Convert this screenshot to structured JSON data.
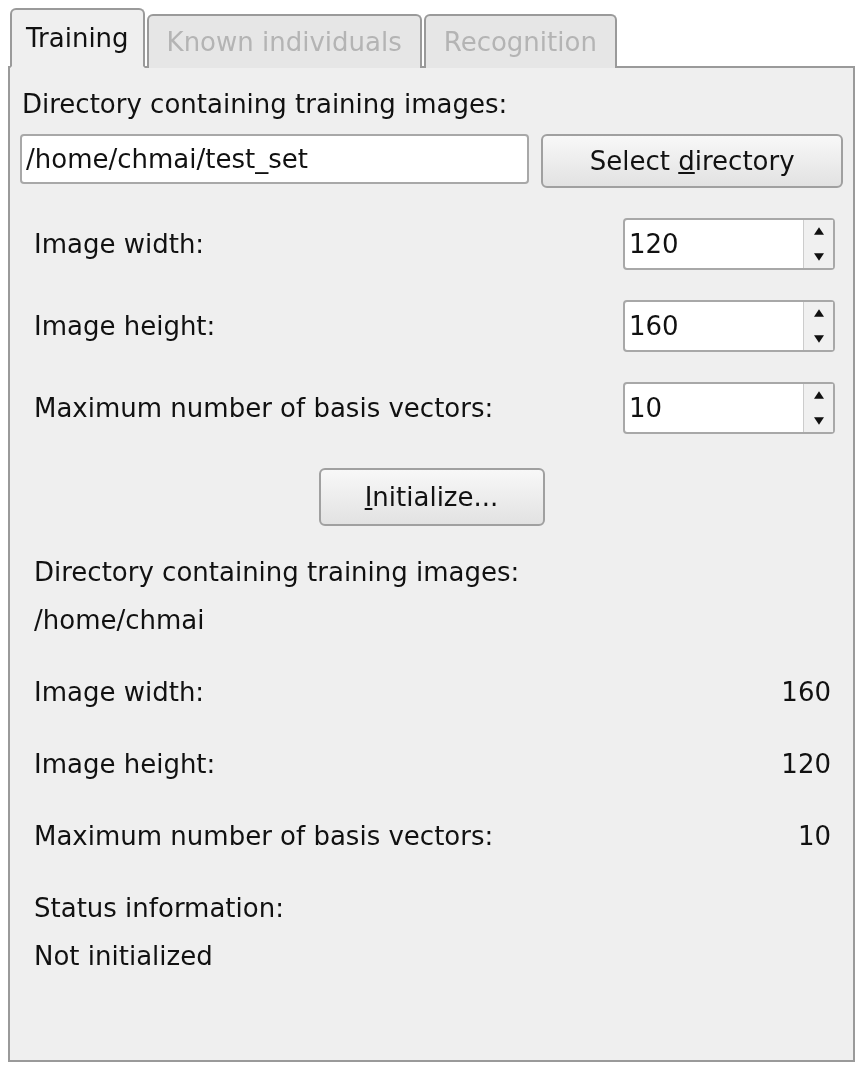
{
  "tabs": [
    {
      "label": "Training",
      "selected": true,
      "disabled": false
    },
    {
      "label": "Known individuals",
      "selected": false,
      "disabled": true
    },
    {
      "label": "Recognition",
      "selected": false,
      "disabled": true
    }
  ],
  "directory": {
    "label": "Directory containing training images:",
    "value": "/home/chmai/test_set",
    "button": {
      "before": "Select ",
      "mnemonic": "d",
      "after": "irectory"
    }
  },
  "settings": [
    {
      "label": "Image width:",
      "value": "120"
    },
    {
      "label": "Image height:",
      "value": "160"
    },
    {
      "label": "Maximum number of basis vectors:",
      "value": "10"
    }
  ],
  "initialize_button": {
    "mnemonic": "I",
    "after": "nitialize..."
  },
  "info": {
    "directory_label": "Directory containing training images:",
    "directory_value": "/home/chmai",
    "rows": [
      {
        "label": "Image width:",
        "value": "160"
      },
      {
        "label": "Image height:",
        "value": "120"
      },
      {
        "label": "Maximum number of basis vectors:",
        "value": "10"
      }
    ],
    "status_label": "Status information:",
    "status_value": "Not initialized"
  }
}
